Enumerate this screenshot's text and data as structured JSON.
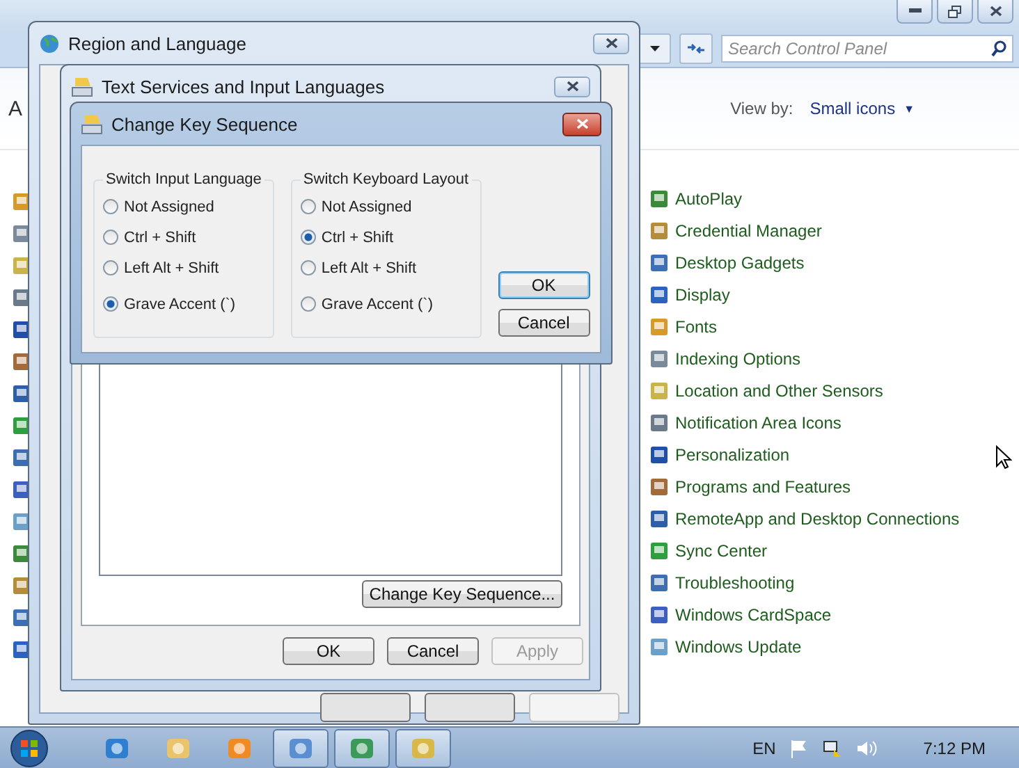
{
  "control_panel": {
    "search": {
      "placeholder": "Search Control Panel"
    },
    "heading": "A",
    "view_by": {
      "label": "View by:",
      "value": "Small icons",
      "arrow": "▼"
    },
    "items": [
      {
        "label": "AutoPlay"
      },
      {
        "label": "Credential Manager"
      },
      {
        "label": "Desktop Gadgets"
      },
      {
        "label": "Display"
      },
      {
        "label": "Fonts"
      },
      {
        "label": "Indexing Options"
      },
      {
        "label": "Location and Other Sensors"
      },
      {
        "label": "Notification Area Icons"
      },
      {
        "label": "Personalization"
      },
      {
        "label": "Programs and Features"
      },
      {
        "label": "RemoteApp and Desktop Connections"
      },
      {
        "label": "Sync Center"
      },
      {
        "label": "Troubleshooting"
      },
      {
        "label": "Windows CardSpace"
      },
      {
        "label": "Windows Update"
      }
    ]
  },
  "region_dialog": {
    "title": "Region and Language"
  },
  "text_services": {
    "title": "Text Services and Input Languages",
    "change_key_button": "Change Key Sequence...",
    "buttons": [
      {
        "label": "OK",
        "disabled": false
      },
      {
        "label": "Cancel",
        "disabled": false
      },
      {
        "label": "Apply",
        "disabled": true
      }
    ]
  },
  "key_sequence": {
    "title": "Change Key Sequence",
    "groups": [
      {
        "title": "Switch Input Language",
        "options": [
          {
            "label": "Not Assigned",
            "selected": false
          },
          {
            "label": "Ctrl + Shift",
            "selected": false
          },
          {
            "label": "Left Alt + Shift",
            "selected": false
          },
          {
            "label": "Grave Accent (`)",
            "selected": true
          }
        ]
      },
      {
        "title": "Switch Keyboard Layout",
        "options": [
          {
            "label": "Not Assigned",
            "selected": false
          },
          {
            "label": "Ctrl + Shift",
            "selected": true
          },
          {
            "label": "Left Alt + Shift",
            "selected": false
          },
          {
            "label": "Grave Accent (`)",
            "selected": false
          }
        ]
      }
    ],
    "buttons": [
      {
        "label": "OK",
        "default": true
      },
      {
        "label": "Cancel",
        "default": false
      }
    ]
  },
  "taskbar": {
    "tasks": [
      {
        "kind": "pinned"
      },
      {
        "kind": "pinned"
      },
      {
        "kind": "pinned"
      },
      {
        "kind": "running"
      },
      {
        "kind": "running"
      },
      {
        "kind": "running"
      }
    ],
    "language": "EN",
    "clock": "7:12 PM"
  }
}
